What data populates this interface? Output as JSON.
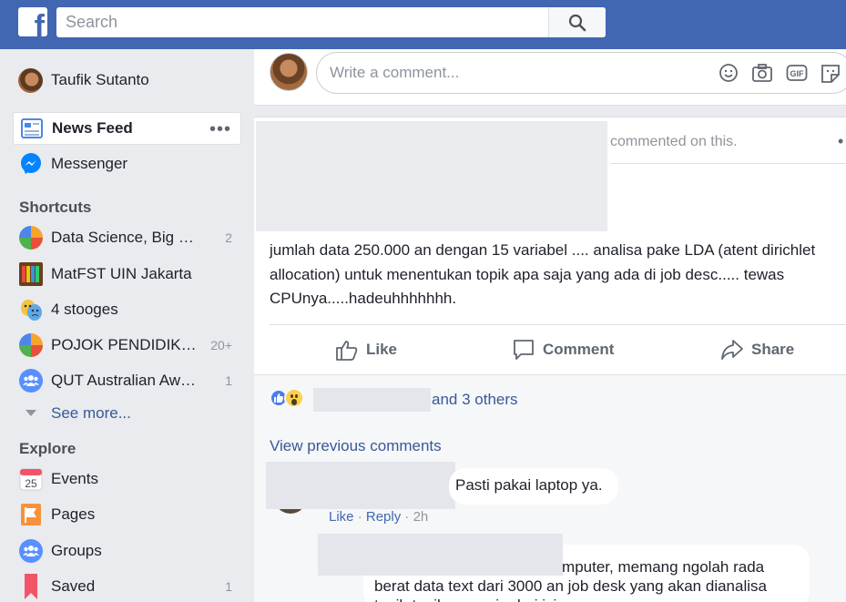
{
  "app": {
    "brand": "facebook",
    "logo_letter": "f",
    "accent": "#4267b2"
  },
  "search": {
    "placeholder": "Search"
  },
  "sidebar": {
    "profile": {
      "name": "Taufik Sutanto"
    },
    "news_feed": {
      "label": "News Feed",
      "more": "•••"
    },
    "messenger": {
      "label": "Messenger"
    },
    "shortcuts_header": "Shortcuts",
    "shortcuts": [
      {
        "label": "Data Science, Big …",
        "count": "2"
      },
      {
        "label": "MatFST UIN Jakarta",
        "count": ""
      },
      {
        "label": "4 stooges",
        "count": ""
      },
      {
        "label": "POJOK PENDIDIK…",
        "count": "20+"
      },
      {
        "label": "QUT Australian Aw…",
        "count": "1"
      }
    ],
    "see_more": "See more...",
    "explore_header": "Explore",
    "explore": [
      {
        "label": "Events",
        "count": "",
        "icon": "calendar-icon",
        "day": "25"
      },
      {
        "label": "Pages",
        "count": "",
        "icon": "flag-icon"
      },
      {
        "label": "Groups",
        "count": "",
        "icon": "groups-icon"
      },
      {
        "label": "Saved",
        "count": "1",
        "icon": "bookmark-icon"
      }
    ]
  },
  "composer": {
    "placeholder": "Write a comment...",
    "gif_label": "GIF"
  },
  "post": {
    "header_text": "commented on this.",
    "body": "jumlah data 250.000 an dengan 15 variabel .... analisa pake LDA (atent dirichlet allocation) untuk menentukan topik apa saja yang ada di job desc..... tewas CPUnya.....hadeuhhhhhhh.",
    "actions": {
      "like": "Like",
      "comment": "Comment",
      "share": "Share"
    },
    "reactions_text": "and 3 others",
    "view_previous": "View previous comments",
    "comments": [
      {
        "text": "Pasti pakai laptop ya.",
        "like": "Like",
        "reply": "Reply",
        "time": "2h",
        "sep": "·"
      },
      {
        "text": "pake ini yang punya lab. komputer, memang ngolah rada berat data text dari 3000 an job desk yang akan dianalisa topik-topik apa saja dari isi"
      }
    ]
  }
}
